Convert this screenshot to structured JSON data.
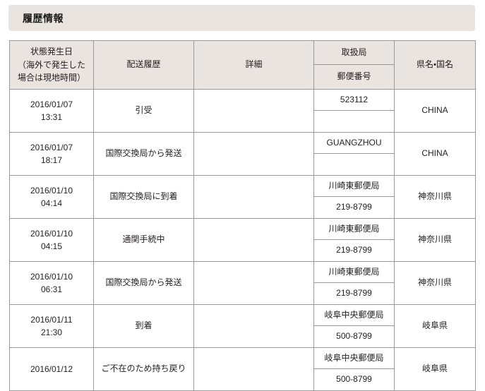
{
  "section": {
    "title": "履歴情報"
  },
  "table": {
    "headers": {
      "date": "状態発生日\n（海外で発生した\n場合は現地時間）",
      "date_line1": "状態発生日",
      "date_line2": "（海外で発生した",
      "date_line3": "場合は現地時間）",
      "history": "配送履歴",
      "detail": "詳細",
      "office": "取扱局",
      "postal_code": "郵便番号",
      "region": "県名・国名"
    },
    "rows": [
      {
        "date": "2016/01/07",
        "time": "13:31",
        "history": "引受",
        "detail": "",
        "office": "523112",
        "postal_code": "",
        "region": "CHINA"
      },
      {
        "date": "2016/01/07",
        "time": "18:17",
        "history": "国際交換局から発送",
        "detail": "",
        "office": "GUANGZHOU",
        "postal_code": "",
        "region": "CHINA"
      },
      {
        "date": "2016/01/10",
        "time": "04:14",
        "history": "国際交換局に到着",
        "detail": "",
        "office": "川崎東郵便局",
        "postal_code": "219-8799",
        "region": "神奈川県"
      },
      {
        "date": "2016/01/10",
        "time": "04:15",
        "history": "通関手続中",
        "detail": "",
        "office": "川崎東郵便局",
        "postal_code": "219-8799",
        "region": "神奈川県"
      },
      {
        "date": "2016/01/10",
        "time": "06:31",
        "history": "国際交換局から発送",
        "detail": "",
        "office": "川崎東郵便局",
        "postal_code": "219-8799",
        "region": "神奈川県"
      },
      {
        "date": "2016/01/11",
        "time": "21:30",
        "history": "到着",
        "detail": "",
        "office": "岐阜中央郵便局",
        "postal_code": "500-8799",
        "region": "岐阜県"
      },
      {
        "date": "2016/01/12",
        "time": "",
        "history": "ご不在のため持ち戻り",
        "detail": "",
        "office": "岐阜中央郵便局",
        "postal_code": "500-8799",
        "region": "岐阜県"
      }
    ]
  },
  "colors": {
    "header_bg": "#e9e4df",
    "border": "#9a9a9a",
    "text": "#231f20",
    "page_bg": "#ffffff"
  }
}
